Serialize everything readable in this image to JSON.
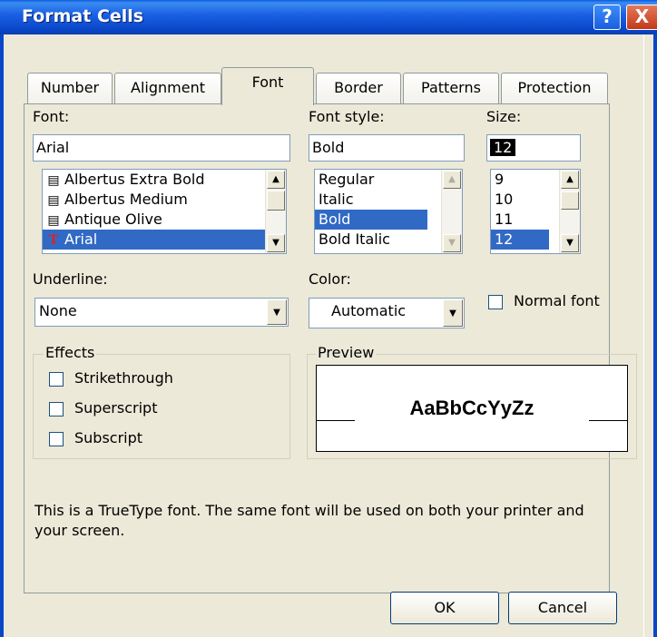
{
  "window": {
    "title": "Format Cells",
    "help_label": "?",
    "close_label": "X"
  },
  "tabs": [
    "Number",
    "Alignment",
    "Font",
    "Border",
    "Patterns",
    "Protection"
  ],
  "font": {
    "label": "Font:",
    "value": "Arial",
    "items": [
      {
        "icon": "printer-font-icon",
        "label": "Albertus Extra Bold"
      },
      {
        "icon": "printer-font-icon",
        "label": "Albertus Medium"
      },
      {
        "icon": "printer-font-icon",
        "label": "Antique Olive"
      },
      {
        "icon": "truetype-font-icon",
        "label": "Arial"
      }
    ]
  },
  "font_style": {
    "label": "Font style:",
    "value": "Bold",
    "items": [
      "Regular",
      "Italic",
      "Bold",
      "Bold Italic"
    ]
  },
  "size": {
    "label": "Size:",
    "value": "12",
    "items": [
      "9",
      "10",
      "11",
      "12"
    ]
  },
  "underline": {
    "label": "Underline:",
    "value": "None"
  },
  "color": {
    "label": "Color:",
    "value": "Automatic"
  },
  "normal_font": {
    "label": "Normal font"
  },
  "effects": {
    "label": "Effects",
    "items": [
      "Strikethrough",
      "Superscript",
      "Subscript"
    ]
  },
  "preview": {
    "label": "Preview",
    "sample": "AaBbCcYyZz"
  },
  "info_text": "This is a TrueType font.  The same font will be used on both your printer and your screen.",
  "buttons": {
    "ok": "OK",
    "cancel": "Cancel"
  },
  "colors": {
    "title_bar": "#0a5ae0",
    "selection": "#316ac5",
    "dialog_bg": "#ece9d8"
  }
}
